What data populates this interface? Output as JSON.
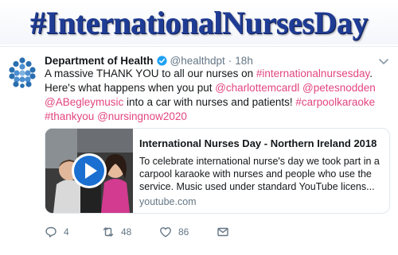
{
  "headline": "#InternationalNursesDay",
  "tweet": {
    "display_name": "Department of Health",
    "handle": "@healthdpt",
    "separator": "·",
    "time": "18h",
    "text": {
      "t1": "A massive THANK YOU to all our nurses on ",
      "l1": "#internationalnursesday",
      "t2": ".  Here's what happens when you put ",
      "l2": "@charlottemcardl",
      "t3": " ",
      "l3": "@petesnodden",
      "t4": " ",
      "l4": "@ABegleymusic",
      "t5": " into a car with nurses and patients! ",
      "l5": "#carpoolkaraoke",
      "t6": " ",
      "l6": "#thankyou",
      "t7": " ",
      "l7": "@nursingnow2020"
    },
    "card": {
      "title": "International Nurses Day - Northern Ireland 2018",
      "description": "To celebrate international nurse's day we took part in a carpool karaoke with nurses and people who use the service. Music used under standard YouTube licens...",
      "domain": "youtube.com"
    },
    "actions": {
      "replies": "4",
      "retweets": "48",
      "likes": "86"
    }
  },
  "colors": {
    "headline": "#1f3c95",
    "link": "#e2457f",
    "verified": "#1da1f2",
    "muted": "#657786",
    "play_button": "#1a6fd1"
  },
  "icons": [
    "avatar-logo-icon",
    "verified-badge-icon",
    "chevron-down-icon",
    "play-icon",
    "reply-icon",
    "retweet-icon",
    "like-icon",
    "message-icon"
  ]
}
